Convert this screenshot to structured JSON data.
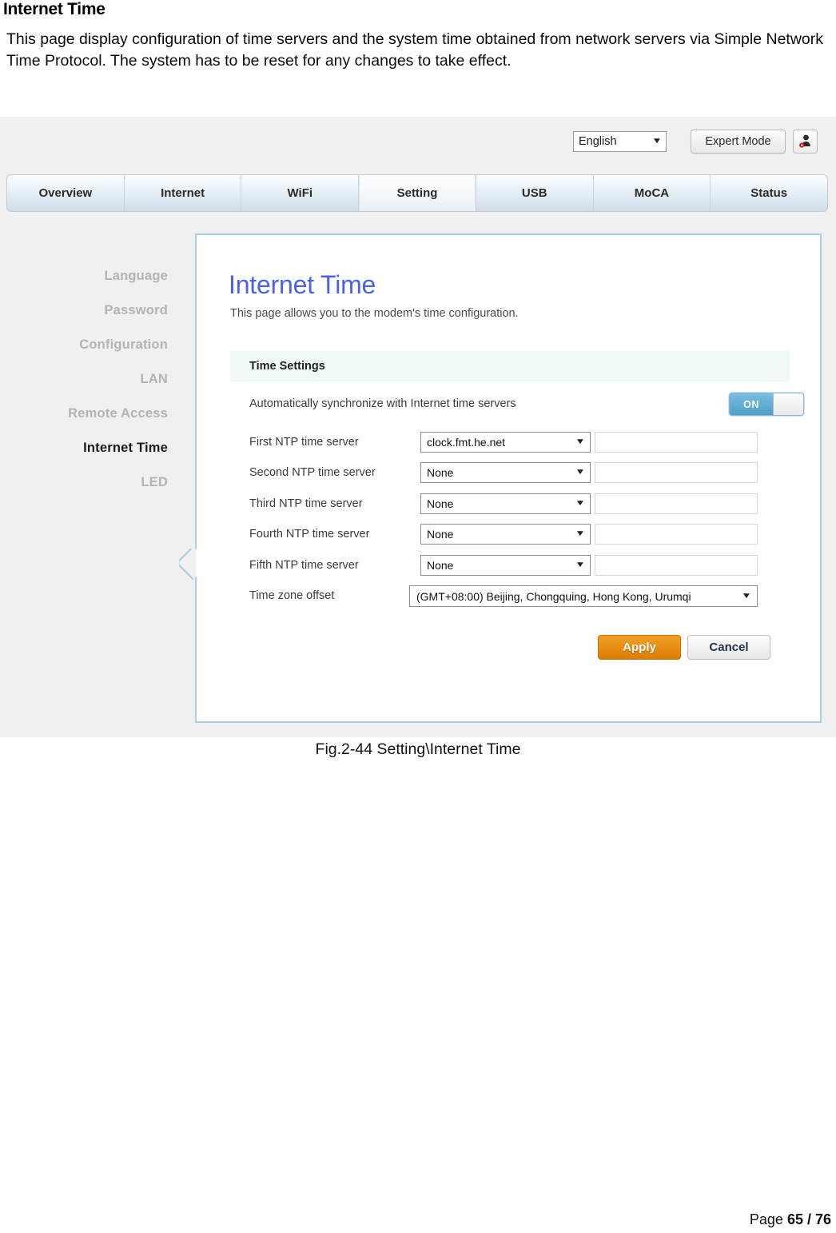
{
  "document": {
    "heading": "Internet Time",
    "paragraph": "This page display configuration of time servers and the system time obtained from network servers via Simple Network Time Protocol. The system has to be reset for any changes to take effect.",
    "figure_caption": "Fig.2-44 Setting\\Internet Time",
    "footer_prefix": "Page ",
    "footer_page": "65 / 76"
  },
  "screenshot": {
    "topbar": {
      "language_value": "English",
      "expert_mode_label": "Expert Mode",
      "user_icon_name": "user-admin-icon"
    },
    "nav_tabs": [
      {
        "label": "Overview",
        "active": false
      },
      {
        "label": "Internet",
        "active": false
      },
      {
        "label": "WiFi",
        "active": false
      },
      {
        "label": "Setting",
        "active": true
      },
      {
        "label": "USB",
        "active": false
      },
      {
        "label": "MoCA",
        "active": false
      },
      {
        "label": "Status",
        "active": false
      }
    ],
    "sidebar": [
      {
        "label": "Language",
        "active": false
      },
      {
        "label": "Password",
        "active": false
      },
      {
        "label": "Configuration",
        "active": false
      },
      {
        "label": "LAN",
        "active": false
      },
      {
        "label": "Remote Access",
        "active": false
      },
      {
        "label": "Internet Time",
        "active": true
      },
      {
        "label": "LED",
        "active": false
      }
    ],
    "panel": {
      "title": "Internet Time",
      "subtitle": "This page allows you to the modem's time configuration.",
      "section_header": "Time Settings",
      "auto_sync": {
        "label": "Automatically synchronize with Internet time servers",
        "state": "ON"
      },
      "ntp_rows": [
        {
          "label": "First NTP time server",
          "value": "clock.fmt.he.net",
          "text_value": ""
        },
        {
          "label": "Second NTP time server",
          "value": "None",
          "text_value": ""
        },
        {
          "label": "Third NTP time server",
          "value": "None",
          "text_value": ""
        },
        {
          "label": "Fourth NTP time server",
          "value": "None",
          "text_value": ""
        },
        {
          "label": "Fifth NTP time server",
          "value": "None",
          "text_value": ""
        }
      ],
      "timezone": {
        "label": "Time zone offset",
        "value": "(GMT+08:00) Beijing, Chongquing, Hong Kong, Urumqi"
      },
      "apply_label": "Apply",
      "cancel_label": "Cancel"
    },
    "colors": {
      "panel_border": "#a9cfe3",
      "title_blue": "#4b62e8",
      "toggle_on": "#4e9fc8",
      "apply_orange": "#dd7d02",
      "section_bg": "#f0f9f8",
      "page_bg": "#f0f0f0"
    }
  }
}
